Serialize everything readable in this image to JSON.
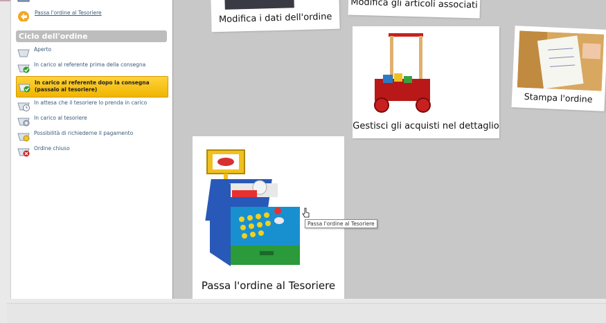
{
  "sidebar": {
    "top_link": "Passa l'ordine al Tesoriere",
    "section_title": "Ciclo dell'ordine",
    "steps": [
      {
        "label": "Aperto",
        "icon": "basket-icon"
      },
      {
        "label": "In carico al referente prima della consegna",
        "icon": "basket-check-icon"
      },
      {
        "label": "In carico al referente dopo la consegna (passalo al tesoriere)",
        "icon": "basket-check-icon",
        "active": true
      },
      {
        "label": "In attesa che il tesoriere lo prenda in carico",
        "icon": "basket-clock-icon"
      },
      {
        "label": "In carico al tesoriere",
        "icon": "basket-gear-icon"
      },
      {
        "label": "Possibilità di richiederne il pagamento",
        "icon": "basket-coin-icon"
      },
      {
        "label": "Ordine chiuso",
        "icon": "basket-closed-icon"
      }
    ]
  },
  "cards": {
    "modifica_dati": "Modifica i dati dell'ordine",
    "modifica_articoli": "Modifica gli articoli associati",
    "gestisci": "Gestisci gli acquisti nel dettaglio",
    "stampa": "Stampa l'ordine",
    "passa": "Passa l'ordine al Tesoriere"
  },
  "tooltip": "Passa l'ordine al Tesoriere",
  "colors": {
    "active_step": "#f5c000",
    "main_bg": "#c8c8c8",
    "section_head": "#bdbdbd"
  }
}
